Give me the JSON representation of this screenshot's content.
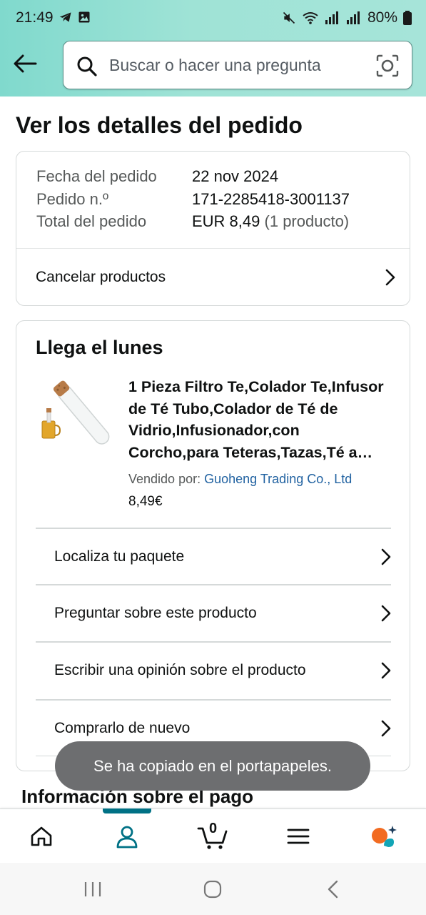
{
  "status_bar": {
    "time": "21:49",
    "battery": "80%"
  },
  "search": {
    "placeholder": "Buscar o hacer una pregunta"
  },
  "page_title": "Ver los detalles del pedido",
  "order_summary": {
    "date_label": "Fecha del pedido",
    "date_value": "22 nov 2024",
    "number_label": "Pedido n.º",
    "number_value": "171-2285418-3001137",
    "total_label": "Total del pedido",
    "total_value": "EUR 8,49",
    "total_count": "(1 producto)",
    "cancel_label": "Cancelar productos"
  },
  "shipment": {
    "arrival": "Llega el lunes",
    "product_title": "1 Pieza Filtro Te,Colador Te,Infusor de Té Tubo,Colador de Té de Vidrio,Infusionador,con Corcho,para Teteras,Tazas,Té a Granel",
    "sold_by_label": "Vendido por:",
    "seller": "Guoheng Trading Co., Ltd",
    "price": "8,49€",
    "actions": [
      {
        "label": "Localiza tu paquete"
      },
      {
        "label": "Preguntar sobre este producto"
      },
      {
        "label": "Escribir una opinión sobre el producto"
      },
      {
        "label": "Comprarlo de nuevo"
      }
    ]
  },
  "payment_section_title": "Información sobre el pago",
  "toast": "Se ha copiado en el portapapeles.",
  "bottom_nav": {
    "cart_count": "0"
  },
  "colors": {
    "header_gradient_start": "#80d9cd",
    "link": "#2162a1",
    "active_tab": "#007185",
    "toast_bg": "#6d6e70"
  }
}
